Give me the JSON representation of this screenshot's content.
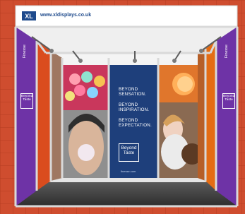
{
  "header": {
    "logo": "XL",
    "url": "www.xldisplays.co.uk"
  },
  "center_panel": {
    "lines": [
      "BEYOND SENSATION.",
      "BEYOND INSPIRATION.",
      "BEYOND EXPECTATION."
    ],
    "badge": "Beyond Taste",
    "website": "finesse.com"
  },
  "left_panel": {
    "brand": "Finesse",
    "badge": "Beyond Taste"
  },
  "right_panel": {
    "brand": "Finesse",
    "badge": "Beyond Taste"
  },
  "colors": {
    "wall": "#c8472a",
    "purple": "#6e33a6",
    "navy": "#1e3f7b",
    "orange": "#e46c14",
    "frame": "#d9d9d9"
  }
}
